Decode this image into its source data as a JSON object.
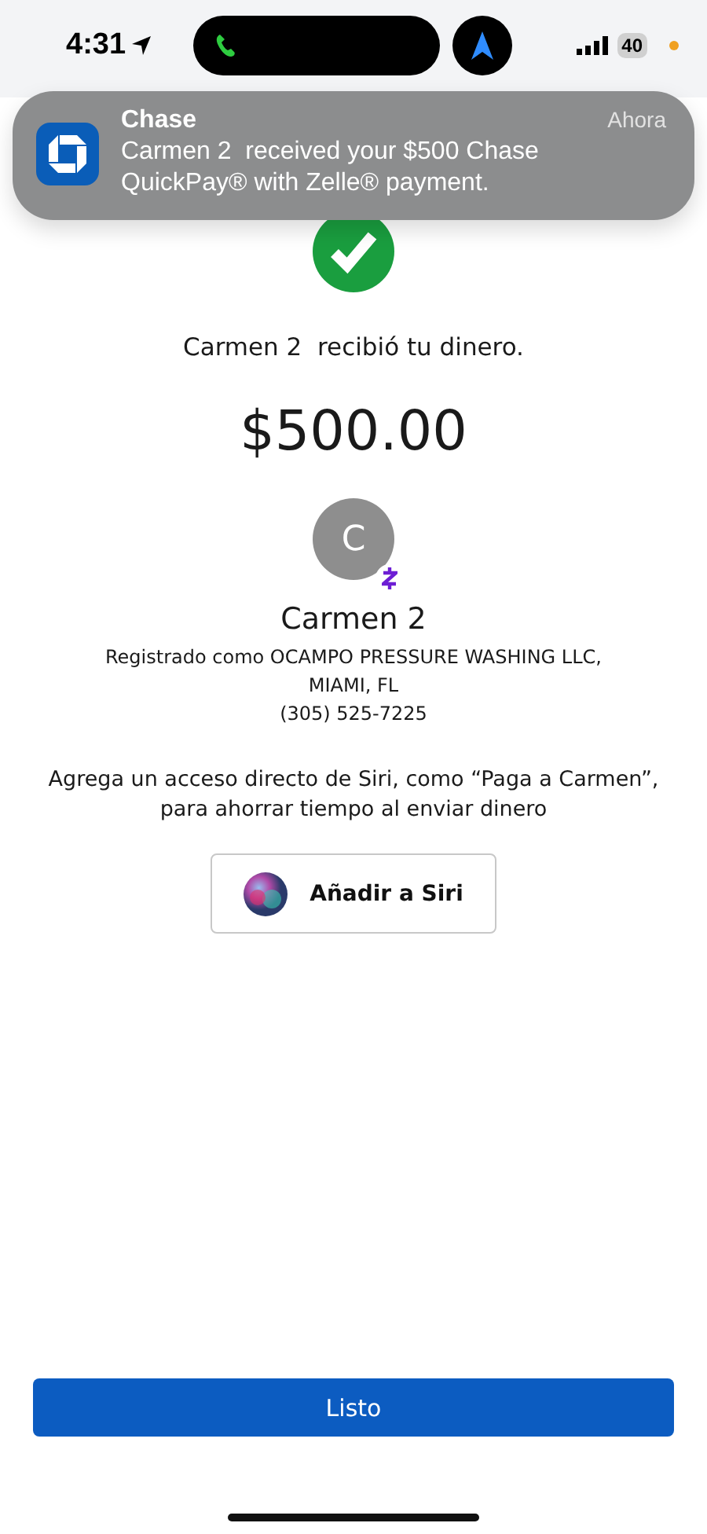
{
  "status_bar": {
    "time": "4:31",
    "battery": "40"
  },
  "notification": {
    "app": "Chase",
    "time": "Ahora",
    "message": "Carmen 2  received your $500 Chase QuickPay® with Zelle® payment."
  },
  "confirmation": {
    "message": "Carmen 2  recibió tu dinero.",
    "amount": "$500.00"
  },
  "recipient": {
    "initial": "C",
    "name": "Carmen 2",
    "registered": "Registrado como OCAMPO PRESSURE WASHING LLC,",
    "location": "MIAMI, FL",
    "phone": "(305) 525-7225"
  },
  "siri": {
    "hint": "Agrega un acceso directo de Siri, como “Paga a Carmen”, para ahorrar tiempo al enviar dinero",
    "button": "Añadir a Siri"
  },
  "done_button": "Listo"
}
